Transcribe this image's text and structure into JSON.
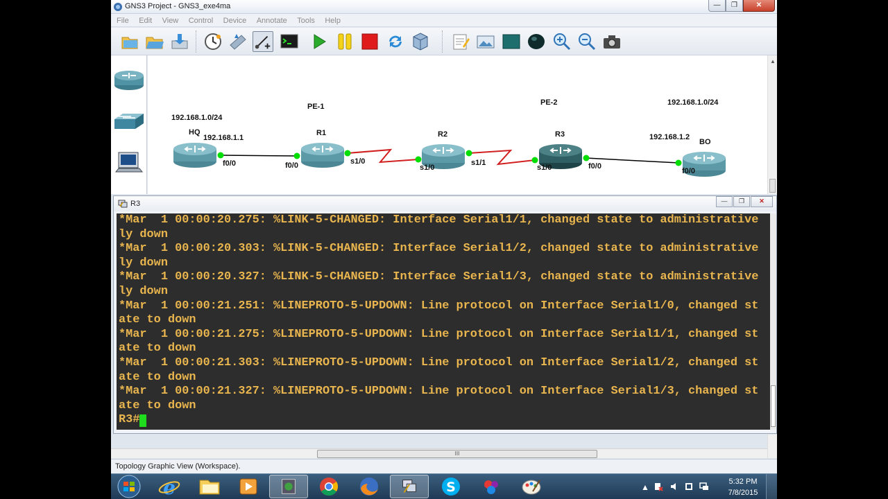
{
  "window": {
    "title": "GNS3 Project - GNS3_exe4ma",
    "controls": {
      "minimize": "—",
      "maximize": "❐",
      "close": "✕"
    }
  },
  "menu": [
    "File",
    "Edit",
    "View",
    "Control",
    "Device",
    "Annotate",
    "Tools",
    "Help"
  ],
  "toolbar": {
    "icons": [
      "new-project-icon",
      "open-project-icon",
      "save-project-icon",
      "snapshot-icon",
      "show-labels-icon",
      "add-link-icon",
      "console-all-icon",
      "start-all-icon",
      "suspend-all-icon",
      "stop-all-icon",
      "reload-all-icon",
      "virtualbox-icon",
      "add-note-icon",
      "insert-picture-icon",
      "draw-rectangle-icon",
      "draw-ellipse-icon",
      "zoom-in-icon",
      "zoom-out-icon",
      "screenshot-icon"
    ]
  },
  "devices_panel": [
    "router-icon",
    "switch-icon",
    "end-device-icon"
  ],
  "topology": {
    "labels": {
      "net_left": "192.168.1.0/24",
      "net_right": "192.168.1.0/24",
      "pe1": "PE-1",
      "pe2": "PE-2",
      "ip_hq": "192.168.1.1",
      "ip_bo": "192.168.1.2"
    },
    "nodes": {
      "hq": "HQ",
      "r1": "R1",
      "r2": "R2",
      "r3": "R3",
      "bo": "BO"
    },
    "ports": {
      "hq_f00": "f0/0",
      "r1_f00": "f0/0",
      "r1_s10": "s1/0",
      "r2_s10": "s1/0",
      "r2_s11": "s1/1",
      "r3_s10": "s1/0",
      "r3_f00": "f0/0",
      "bo_f00": "f0/0"
    },
    "colors": {
      "ethernet_link": "#000000",
      "serial_link": "#d11e1e",
      "port_up": "#00dd00",
      "router": "#5c9aa8",
      "router_selected": "#2f5e63"
    }
  },
  "console": {
    "title": "R3",
    "lines": [
      "*Mar  1 00:00:20.275: %LINK-5-CHANGED: Interface Serial1/1, changed state to administrative",
      "ly down",
      "*Mar  1 00:00:20.303: %LINK-5-CHANGED: Interface Serial1/2, changed state to administrative",
      "ly down",
      "*Mar  1 00:00:20.327: %LINK-5-CHANGED: Interface Serial1/3, changed state to administrative",
      "ly down",
      "*Mar  1 00:00:21.251: %LINEPROTO-5-UPDOWN: Line protocol on Interface Serial1/0, changed st",
      "ate to down",
      "*Mar  1 00:00:21.275: %LINEPROTO-5-UPDOWN: Line protocol on Interface Serial1/1, changed st",
      "ate to down",
      "*Mar  1 00:00:21.303: %LINEPROTO-5-UPDOWN: Line protocol on Interface Serial1/2, changed st",
      "ate to down",
      "*Mar  1 00:00:21.327: %LINEPROTO-5-UPDOWN: Line protocol on Interface Serial1/3, changed st",
      "ate to down"
    ],
    "prompt": "R3#",
    "text_color": "#e9b54e",
    "cursor_color": "#1fdc1f"
  },
  "scrollbar": {
    "grip": "III"
  },
  "status": "Topology Graphic View (Workspace).",
  "taskbar": {
    "apps": [
      "ie-icon",
      "explorer-icon",
      "media-player-icon",
      "gns3-taskbar-icon",
      "chrome-icon",
      "firefox-icon",
      "console-taskbar-icon",
      "skype-icon",
      "app-icon",
      "paint-icon"
    ],
    "clock_time": "5:32 PM",
    "clock_date": "7/8/2015"
  }
}
